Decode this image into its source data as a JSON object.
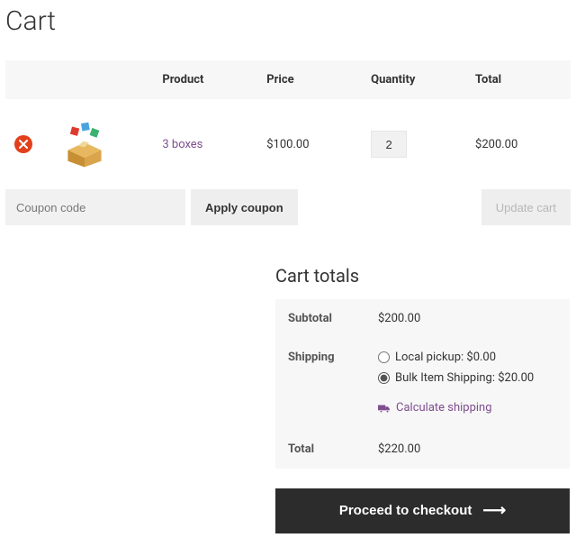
{
  "page": {
    "title": "Cart"
  },
  "tableHeaders": {
    "product": "Product",
    "price": "Price",
    "quantity": "Quantity",
    "total": "Total"
  },
  "items": [
    {
      "name": "3 boxes",
      "price": "$100.00",
      "quantity": "2",
      "lineTotal": "$200.00"
    }
  ],
  "coupon": {
    "placeholder": "Coupon code",
    "applyLabel": "Apply coupon"
  },
  "updateLabel": "Update cart",
  "totals": {
    "title": "Cart totals",
    "subtotalLabel": "Subtotal",
    "subtotalValue": "$200.00",
    "shippingLabel": "Shipping",
    "shippingOptions": [
      {
        "label": "Local pickup:",
        "price": "$0.00",
        "selected": false
      },
      {
        "label": "Bulk Item Shipping:",
        "price": "$20.00",
        "selected": true
      }
    ],
    "calculateLabel": "Calculate shipping",
    "totalLabel": "Total",
    "totalValue": "$220.00"
  },
  "checkoutLabel": "Proceed to checkout"
}
